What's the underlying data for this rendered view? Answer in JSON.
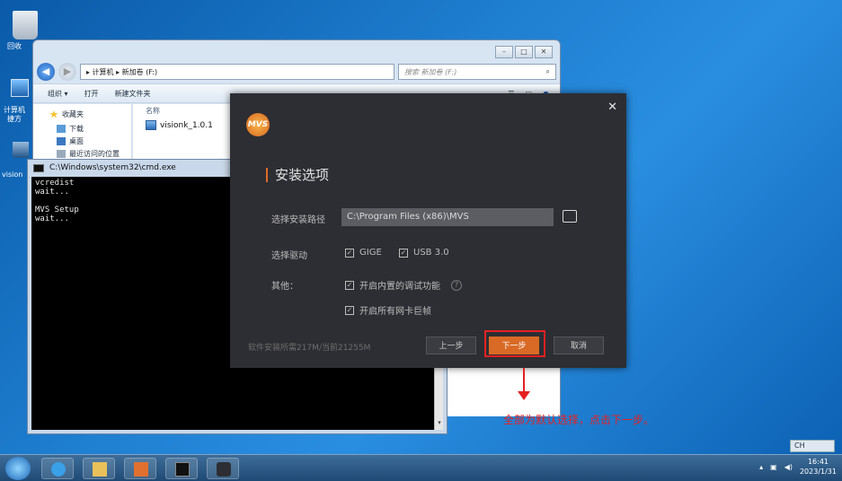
{
  "desktop": {
    "recycle_label": "回收",
    "computer_label": "计算机\n捷方",
    "vision_label": "vision"
  },
  "explorer": {
    "breadcrumb": "▸ 计算机 ▸ 新加卷 (F:)",
    "search_placeholder": "搜索 新加卷 (F:)",
    "toolbar": {
      "organize": "组织 ▾",
      "open": "打开",
      "new_folder": "新建文件夹"
    },
    "nav": {
      "favorites": "收藏夹",
      "downloads": "下载",
      "desktop": "桌面",
      "recent": "最近访问的位置"
    },
    "col_name": "名称",
    "file": "visionk_1.0.1"
  },
  "cmd": {
    "title": "C:\\Windows\\system32\\cmd.exe",
    "output": "vcredist\nwait...\n\nMVS Setup\nwait..."
  },
  "installer": {
    "logo": "MVS",
    "close": "✕",
    "title": "安装选项",
    "path_label": "选择安装路径",
    "path_value": "C:\\Program Files (x86)\\MVS",
    "driver_label": "选择驱动",
    "drivers": [
      "GIGE",
      "USB 3.0"
    ],
    "other_label": "其他：",
    "options": [
      "开启内置的调试功能",
      "开启所有网卡巨帧"
    ],
    "space_info": "软件安装所需217M/当前21255M",
    "btn_prev": "上一步",
    "btn_next": "下一步",
    "btn_cancel": "取消"
  },
  "annotation": "全部为默认选择，点击下一步。",
  "taskbar": {
    "lang": "CH",
    "time": "16:41",
    "date": "2023/1/31"
  },
  "colors": {
    "accent": "#d96a26",
    "annotation": "#e52121"
  }
}
